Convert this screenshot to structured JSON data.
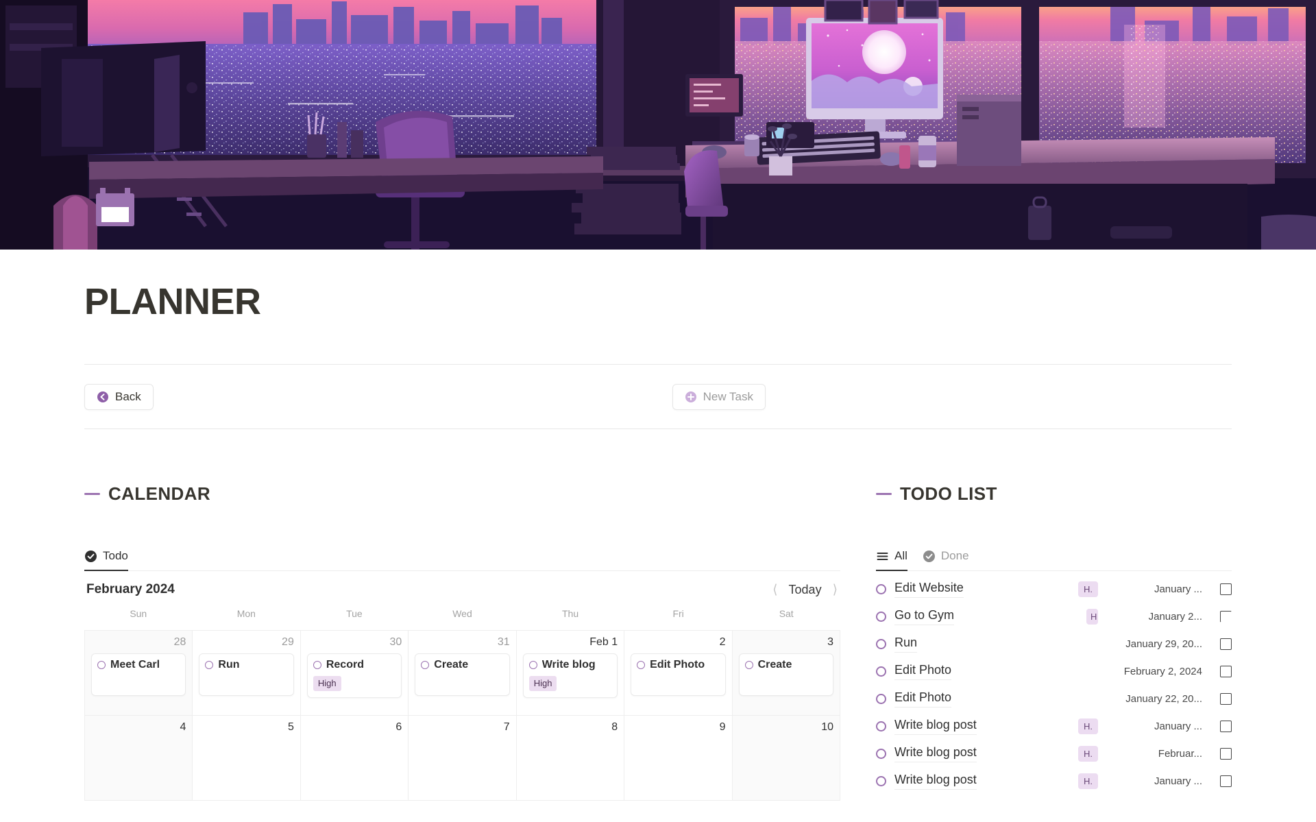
{
  "hero": {
    "alt": "lofi purple cityscape office at dusk",
    "colors": {
      "sky_top": "#f06fa8",
      "sky_mid": "#b263c9",
      "city_glow": "#6d50b8",
      "room_dark": "#180f26",
      "accent": "#c77ae0"
    }
  },
  "icon": {
    "name": "calendar-emoji",
    "color": "#9b72b0"
  },
  "header": {
    "title": "PLANNER"
  },
  "toolbar": {
    "back_label": "Back",
    "back_icon": "back-arrow-circle-icon",
    "new_task_label": "New Task",
    "new_task_icon": "plus-circle-icon"
  },
  "calendar_section": {
    "title": "CALENDAR",
    "tabs": [
      {
        "label": "Todo",
        "icon": "check-circle-icon",
        "active": true
      }
    ],
    "month_label": "February 2024",
    "today_label": "Today",
    "prev_icon": "chevron-left-icon",
    "next_icon": "chevron-right-icon",
    "weekdays": [
      "Sun",
      "Mon",
      "Tue",
      "Wed",
      "Thu",
      "Fri",
      "Sat"
    ],
    "weeks": [
      [
        {
          "day": "28",
          "current_month": false,
          "weekend": true,
          "event": {
            "title": "Meet Carl",
            "priority": null
          }
        },
        {
          "day": "29",
          "current_month": false,
          "weekend": false,
          "event": {
            "title": "Run",
            "priority": null
          }
        },
        {
          "day": "30",
          "current_month": false,
          "weekend": false,
          "event": {
            "title": "Record",
            "priority": "High"
          }
        },
        {
          "day": "31",
          "current_month": false,
          "weekend": false,
          "event": {
            "title": "Create",
            "priority": null
          }
        },
        {
          "day": "Feb 1",
          "current_month": true,
          "weekend": false,
          "event": {
            "title": "Write blog",
            "priority": "High"
          }
        },
        {
          "day": "2",
          "current_month": true,
          "weekend": false,
          "event": {
            "title": "Edit Photo",
            "priority": null
          }
        },
        {
          "day": "3",
          "current_month": true,
          "weekend": true,
          "event": {
            "title": "Create",
            "priority": null
          }
        }
      ],
      [
        {
          "day": "4",
          "current_month": true,
          "weekend": true,
          "event": null
        },
        {
          "day": "5",
          "current_month": true,
          "weekend": false,
          "event": null
        },
        {
          "day": "6",
          "current_month": true,
          "weekend": false,
          "event": null
        },
        {
          "day": "7",
          "current_month": true,
          "weekend": false,
          "event": null
        },
        {
          "day": "8",
          "current_month": true,
          "weekend": false,
          "event": null
        },
        {
          "day": "9",
          "current_month": true,
          "weekend": false,
          "event": null
        },
        {
          "day": "10",
          "current_month": true,
          "weekend": true,
          "event": null
        }
      ]
    ]
  },
  "todo_section": {
    "title": "TODO LIST",
    "tabs": [
      {
        "label": "All",
        "icon": "list-lines-icon",
        "active": true
      },
      {
        "label": "Done",
        "icon": "check-circle-icon",
        "active": false
      }
    ],
    "items": [
      {
        "name": "Edit Website",
        "priority": "H.",
        "date": "January ...",
        "done": false
      },
      {
        "name": "Go to Gym",
        "priority": "H",
        "date": "January 2...",
        "done": false
      },
      {
        "name": "Run",
        "priority": null,
        "date": "January 29, 20...",
        "done": false
      },
      {
        "name": "Edit Photo",
        "priority": null,
        "date": "February 2, 2024",
        "done": false
      },
      {
        "name": "Edit Photo",
        "priority": null,
        "date": "January 22, 20...",
        "done": false
      },
      {
        "name": "Write blog post",
        "priority": "H.",
        "date": "January ...",
        "done": false
      },
      {
        "name": "Write blog post",
        "priority": "H.",
        "date": "Februar...",
        "done": false
      },
      {
        "name": "Write blog post",
        "priority": "H.",
        "date": "January ...",
        "done": false
      }
    ]
  }
}
